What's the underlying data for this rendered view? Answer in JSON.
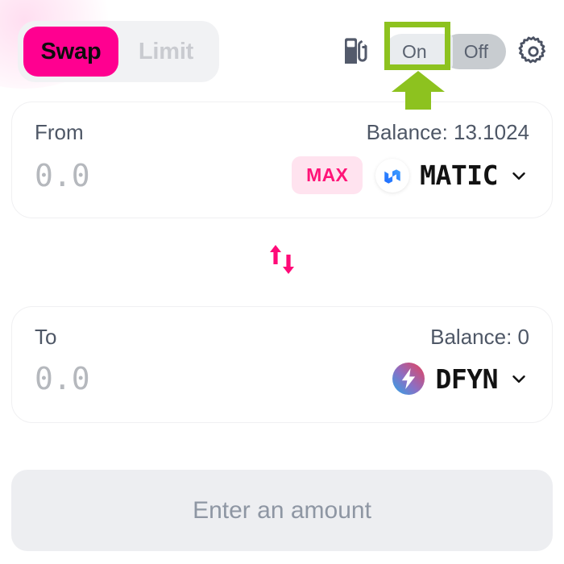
{
  "header": {
    "mode_tabs": [
      {
        "label": "Swap",
        "active": true
      },
      {
        "label": "Limit",
        "active": false
      }
    ],
    "gas_icon": "gas-pump-icon",
    "gas_toggle": {
      "on_label": "On",
      "off_label": "Off",
      "selected": "On"
    },
    "settings_icon": "gear-icon"
  },
  "annotation": {
    "highlight_color": "#8dc21f",
    "target": "On",
    "arrow_icon": "up-arrow-annotation"
  },
  "from": {
    "label": "From",
    "balance_text": "Balance: 13.1024",
    "amount_value": "",
    "amount_placeholder": "0.0",
    "max_label": "MAX",
    "token_symbol": "MATIC",
    "token_logo": "matic-logo-icon",
    "chevron_icon": "chevron-down-icon"
  },
  "switch_button": {
    "icon": "swap-direction-arrows-icon",
    "color": "#ff0a78"
  },
  "to": {
    "label": "To",
    "balance_text": "Balance: 0",
    "amount_value": "",
    "amount_placeholder": "0.0",
    "token_symbol": "DFYN",
    "token_logo": "dfyn-logo-icon",
    "chevron_icon": "chevron-down-icon"
  },
  "action": {
    "label": "Enter an amount",
    "enabled": false
  },
  "theme": {
    "accent_pink": "#ff0090",
    "max_pink": "#ff1478",
    "annotation_green": "#8dc21f",
    "muted_text": "#4e5766",
    "disabled_bg": "#edeef1"
  }
}
